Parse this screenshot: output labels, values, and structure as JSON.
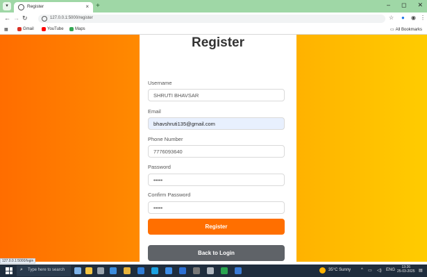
{
  "browser": {
    "tab_title": "Register",
    "tab_close": "×",
    "new_tab": "+",
    "url": "127.0.0.1:5000/register",
    "window_controls": {
      "minimize": "–",
      "maximize": "◻",
      "close": "✕"
    },
    "bookmarks": [
      {
        "label": "Gmail",
        "color": "#d93025"
      },
      {
        "label": "YouTube",
        "color": "#ff0000"
      },
      {
        "label": "Maps",
        "color": "#34a853"
      }
    ],
    "all_bookmarks": "All Bookmarks"
  },
  "form": {
    "title": "Register",
    "fields": [
      {
        "label": "Username",
        "value": "SHRUTI BHAVSAR",
        "autofill": false
      },
      {
        "label": "Email",
        "value": "bhavshruti135@gmail.com",
        "autofill": true
      },
      {
        "label": "Phone Number",
        "value": "7776093640",
        "autofill": false
      },
      {
        "label": "Password",
        "value": "•••••",
        "autofill": false
      },
      {
        "label": "Confirm Password",
        "value": "•••••",
        "autofill": false
      }
    ],
    "register_button": "Register",
    "back_button": "Back to Login"
  },
  "status_link": "127.0.0.1:5000/login",
  "taskbar": {
    "search_placeholder": "Type here to search",
    "weather": "35°C Sunny",
    "lang": "ENG",
    "time": "13:26",
    "date": "25-03-2025"
  },
  "colors": {
    "gradient_start": "#ff6d00",
    "gradient_end": "#ffcc00",
    "register_button": "#ff6f00",
    "back_button": "#5f6368"
  }
}
